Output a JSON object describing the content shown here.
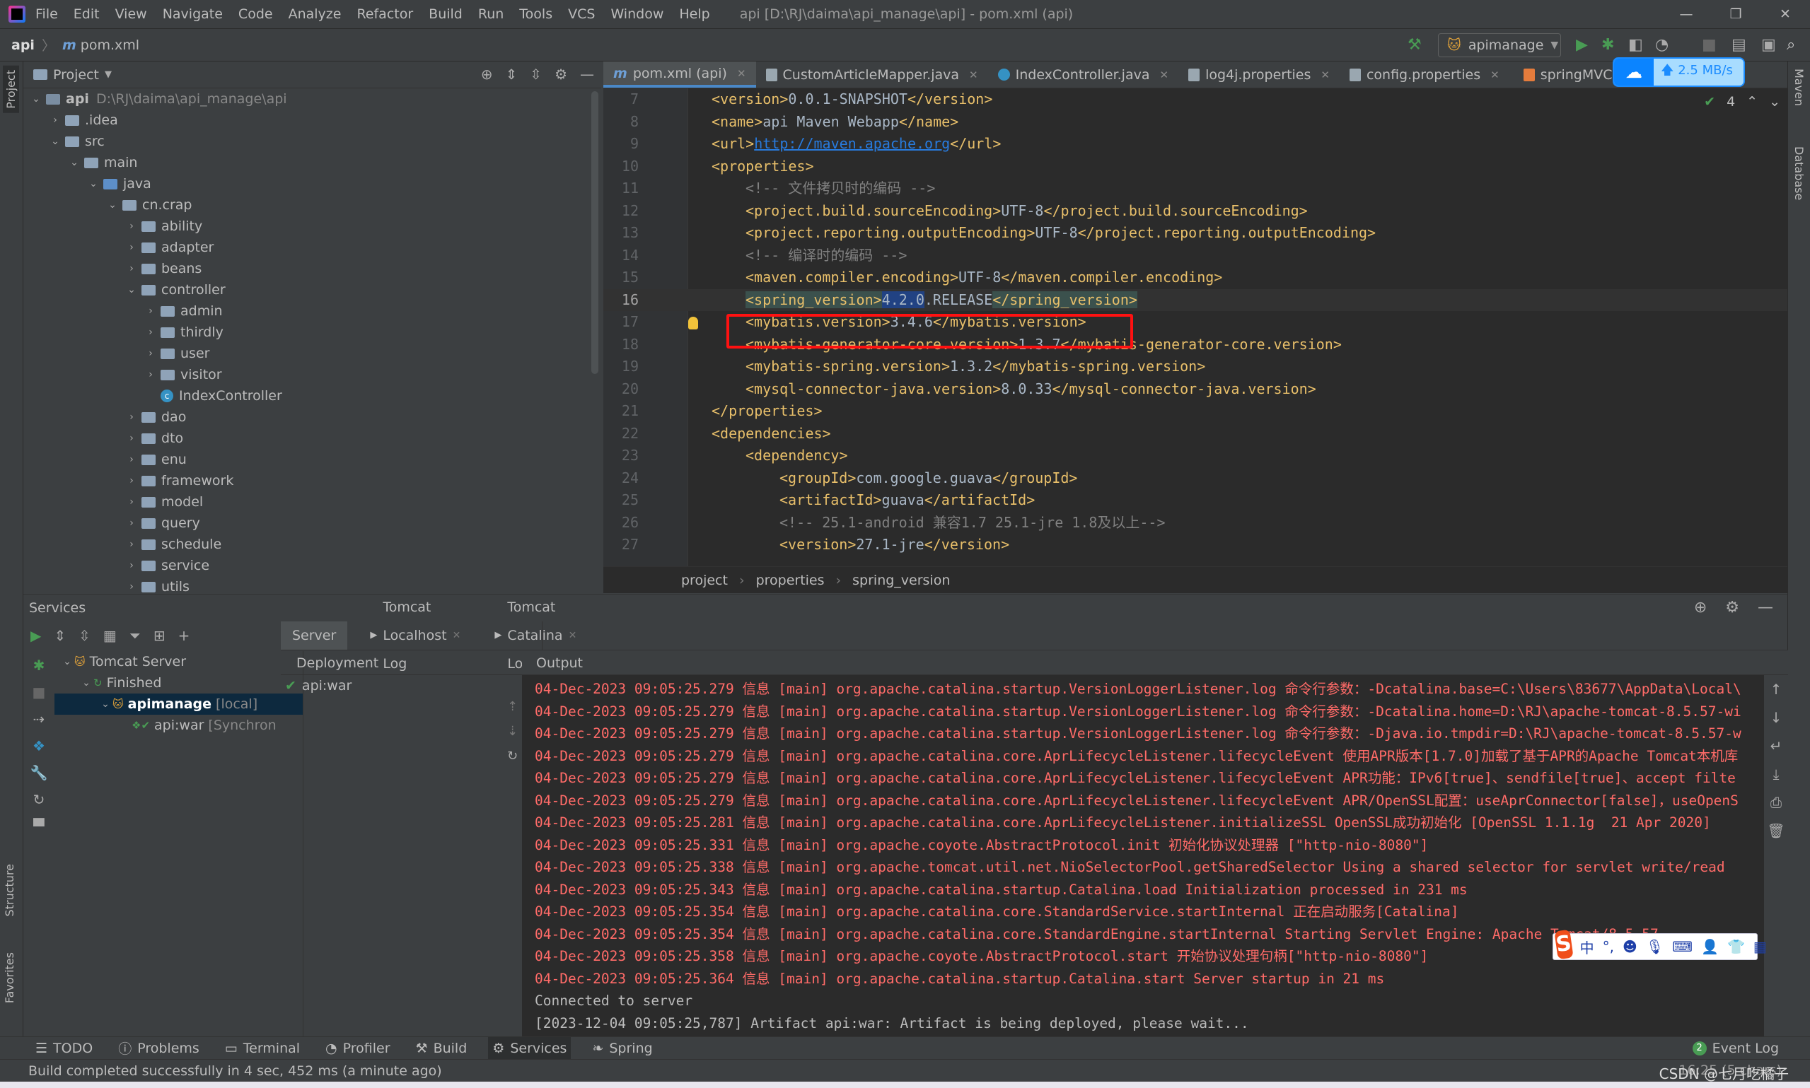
{
  "titlebar": {
    "menu": [
      "File",
      "Edit",
      "View",
      "Navigate",
      "Code",
      "Analyze",
      "Refactor",
      "Build",
      "Run",
      "Tools",
      "VCS",
      "Window",
      "Help"
    ],
    "title": "api [D:\\RJ\\daima\\api_manage\\api] - pom.xml (api)"
  },
  "navbar": {
    "crumbs": [
      "api",
      "pom.xml"
    ],
    "run_config": "apimanage"
  },
  "left_stripe": {
    "labels": [
      "Project",
      "Structure",
      "Favorites"
    ]
  },
  "right_stripe": {
    "labels": [
      "Maven",
      "Database"
    ]
  },
  "project": {
    "title": "Project",
    "tree": [
      {
        "label": "api",
        "path": "D:\\RJ\\daima\\api_manage\\api",
        "depth": 0,
        "arrow": "open",
        "icon": "module"
      },
      {
        "label": ".idea",
        "depth": 1,
        "arrow": "closed",
        "icon": "folder"
      },
      {
        "label": "src",
        "depth": 1,
        "arrow": "open",
        "icon": "folder"
      },
      {
        "label": "main",
        "depth": 2,
        "arrow": "open",
        "icon": "folder"
      },
      {
        "label": "java",
        "depth": 3,
        "arrow": "open",
        "icon": "source"
      },
      {
        "label": "cn.crap",
        "depth": 4,
        "arrow": "open",
        "icon": "folder"
      },
      {
        "label": "ability",
        "depth": 5,
        "arrow": "closed",
        "icon": "folder"
      },
      {
        "label": "adapter",
        "depth": 5,
        "arrow": "closed",
        "icon": "folder"
      },
      {
        "label": "beans",
        "depth": 5,
        "arrow": "closed",
        "icon": "folder"
      },
      {
        "label": "controller",
        "depth": 5,
        "arrow": "open",
        "icon": "folder"
      },
      {
        "label": "admin",
        "depth": 6,
        "arrow": "closed",
        "icon": "folder"
      },
      {
        "label": "thirdly",
        "depth": 6,
        "arrow": "closed",
        "icon": "folder"
      },
      {
        "label": "user",
        "depth": 6,
        "arrow": "closed",
        "icon": "folder"
      },
      {
        "label": "visitor",
        "depth": 6,
        "arrow": "closed",
        "icon": "folder"
      },
      {
        "label": "IndexController",
        "depth": 6,
        "arrow": "none",
        "icon": "class"
      },
      {
        "label": "dao",
        "depth": 5,
        "arrow": "closed",
        "icon": "folder"
      },
      {
        "label": "dto",
        "depth": 5,
        "arrow": "closed",
        "icon": "folder"
      },
      {
        "label": "enu",
        "depth": 5,
        "arrow": "closed",
        "icon": "folder"
      },
      {
        "label": "framework",
        "depth": 5,
        "arrow": "closed",
        "icon": "folder"
      },
      {
        "label": "model",
        "depth": 5,
        "arrow": "closed",
        "icon": "folder"
      },
      {
        "label": "query",
        "depth": 5,
        "arrow": "closed",
        "icon": "folder"
      },
      {
        "label": "schedule",
        "depth": 5,
        "arrow": "closed",
        "icon": "folder"
      },
      {
        "label": "service",
        "depth": 5,
        "arrow": "closed",
        "icon": "folder"
      },
      {
        "label": "utils",
        "depth": 5,
        "arrow": "closed",
        "icon": "folder"
      }
    ]
  },
  "editor": {
    "tabs": [
      {
        "label": "pom.xml (api)",
        "icon": "m",
        "active": true
      },
      {
        "label": "CustomArticleMapper.java",
        "icon": "f"
      },
      {
        "label": "IndexController.java",
        "icon": "c"
      },
      {
        "label": "log4j.properties",
        "icon": "f"
      },
      {
        "label": "config.properties",
        "icon": "f"
      },
      {
        "label": "springMVC.xml",
        "icon": "x"
      }
    ],
    "upload_widget": "2.5 MB/s",
    "inspection_count": "4",
    "lines": [
      {
        "n": "7",
        "i": 1,
        "p": [
          [
            "<version>",
            "tag"
          ],
          [
            "0.0.1-SNAPSHOT",
            "txt"
          ],
          [
            "</version>",
            "tag"
          ]
        ]
      },
      {
        "n": "8",
        "i": 1,
        "p": [
          [
            "<name>",
            "tag"
          ],
          [
            "api Maven Webapp",
            "txt"
          ],
          [
            "</name>",
            "tag"
          ]
        ]
      },
      {
        "n": "9",
        "i": 1,
        "p": [
          [
            "<url>",
            "tag"
          ],
          [
            "http://maven.apache.org",
            "url"
          ],
          [
            "</url>",
            "tag"
          ]
        ]
      },
      {
        "n": "10",
        "i": 1,
        "p": [
          [
            "<properties>",
            "tag"
          ]
        ]
      },
      {
        "n": "11",
        "i": 2,
        "p": [
          [
            "<!-- 文件拷贝时的编码 -->",
            "com"
          ]
        ]
      },
      {
        "n": "12",
        "i": 2,
        "p": [
          [
            "<project.build.sourceEncoding>",
            "tag"
          ],
          [
            "UTF-8",
            "txt"
          ],
          [
            "</project.build.sourceEncoding>",
            "tag"
          ]
        ]
      },
      {
        "n": "13",
        "i": 2,
        "p": [
          [
            "<project.reporting.outputEncoding>",
            "tag"
          ],
          [
            "UTF-8",
            "txt"
          ],
          [
            "</project.reporting.outputEncoding>",
            "tag"
          ]
        ]
      },
      {
        "n": "14",
        "i": 2,
        "p": [
          [
            "<!-- 编译时的编码 -->",
            "com"
          ]
        ]
      },
      {
        "n": "15",
        "i": 2,
        "p": [
          [
            "<maven.compiler.encoding>",
            "tag"
          ],
          [
            "UTF-8",
            "txt"
          ],
          [
            "</maven.compiler.encoding>",
            "tag"
          ]
        ]
      },
      {
        "n": "16",
        "i": 2,
        "cur": true,
        "p": [
          [
            "<spring_version>",
            "tag hl"
          ],
          [
            "4.2.0",
            "txt sel"
          ],
          [
            ".RELEASE",
            "txt"
          ],
          [
            "</spring_version>",
            "tag hl"
          ]
        ]
      },
      {
        "n": "17",
        "i": 2,
        "p": [
          [
            "<mybatis.version>",
            "tag"
          ],
          [
            "3.4.6",
            "txt"
          ],
          [
            "</mybatis.version>",
            "tag"
          ]
        ]
      },
      {
        "n": "18",
        "i": 2,
        "p": [
          [
            "<mybatis-generator-core.version>",
            "tag"
          ],
          [
            "1.3.7",
            "txt"
          ],
          [
            "</mybatis-generator-core.version>",
            "tag"
          ]
        ]
      },
      {
        "n": "19",
        "i": 2,
        "p": [
          [
            "<mybatis-spring.version>",
            "tag"
          ],
          [
            "1.3.2",
            "txt"
          ],
          [
            "</mybatis-spring.version>",
            "tag"
          ]
        ]
      },
      {
        "n": "20",
        "i": 2,
        "p": [
          [
            "<mysql-connector-java.version>",
            "tag"
          ],
          [
            "8.0.33",
            "txt"
          ],
          [
            "</mysql-connector-java.version>",
            "tag"
          ]
        ]
      },
      {
        "n": "21",
        "i": 1,
        "p": [
          [
            "</properties>",
            "tag"
          ]
        ]
      },
      {
        "n": "22",
        "i": 1,
        "p": [
          [
            "<dependencies>",
            "tag"
          ]
        ]
      },
      {
        "n": "23",
        "i": 2,
        "p": [
          [
            "<dependency>",
            "tag"
          ]
        ]
      },
      {
        "n": "24",
        "i": 3,
        "p": [
          [
            "<groupId>",
            "tag"
          ],
          [
            "com.google.guava",
            "txt"
          ],
          [
            "</groupId>",
            "tag"
          ]
        ]
      },
      {
        "n": "25",
        "i": 3,
        "p": [
          [
            "<artifactId>",
            "tag"
          ],
          [
            "guava",
            "txt"
          ],
          [
            "</artifactId>",
            "tag"
          ]
        ]
      },
      {
        "n": "26",
        "i": 3,
        "p": [
          [
            "<!-- 25.1-android 兼容1.7 25.1-jre 1.8及以上-->",
            "com"
          ]
        ]
      },
      {
        "n": "27",
        "i": 3,
        "p": [
          [
            "<version>",
            "tag"
          ],
          [
            "27.1-jre",
            "txt"
          ],
          [
            "</version>",
            "tag"
          ]
        ]
      }
    ],
    "breadcrumbs": [
      "project",
      "properties",
      "spring_version"
    ]
  },
  "services": {
    "title": "Services",
    "tree": [
      {
        "label": "Tomcat Server",
        "depth": 0,
        "arrow": "open"
      },
      {
        "label": "Finished",
        "depth": 1,
        "arrow": "open"
      },
      {
        "label": "apimanage",
        "suffix": "[local]",
        "depth": 2,
        "arrow": "open",
        "selected": true
      },
      {
        "label": "api:war",
        "suffix": "[Synchron",
        "depth": 3,
        "arrow": "none"
      }
    ],
    "tabs": [
      "Server",
      "Tomcat Localhost Log",
      "Tomcat Catalina Log"
    ],
    "deployment_header": "Deployment",
    "deployment_item": "api:war",
    "output_header": "Output",
    "log": [
      {
        "t": "04-Dec-2023 09:05:25.279 信息 [main] org.apache.catalina.startup.VersionLoggerListener.log 命令行参数：-Dcatalina.base=C:\\Users\\83677\\AppData\\Local\\",
        "k": "err"
      },
      {
        "t": "04-Dec-2023 09:05:25.279 信息 [main] org.apache.catalina.startup.VersionLoggerListener.log 命令行参数：-Dcatalina.home=D:\\RJ\\apache-tomcat-8.5.57-wi",
        "k": "err"
      },
      {
        "t": "04-Dec-2023 09:05:25.279 信息 [main] org.apache.catalina.startup.VersionLoggerListener.log 命令行参数：-Djava.io.tmpdir=D:\\RJ\\apache-tomcat-8.5.57-w",
        "k": "err"
      },
      {
        "t": "04-Dec-2023 09:05:25.279 信息 [main] org.apache.catalina.core.AprLifecycleListener.lifecycleEvent 使用APR版本[1.7.0]加载了基于APR的Apache Tomcat本机库",
        "k": "err"
      },
      {
        "t": "04-Dec-2023 09:05:25.279 信息 [main] org.apache.catalina.core.AprLifecycleListener.lifecycleEvent APR功能：IPv6[true]、sendfile[true]、accept filte",
        "k": "err"
      },
      {
        "t": "04-Dec-2023 09:05:25.279 信息 [main] org.apache.catalina.core.AprLifecycleListener.lifecycleEvent APR/OpenSSL配置：useAprConnector[false]，useOpenS",
        "k": "err"
      },
      {
        "t": "04-Dec-2023 09:05:25.281 信息 [main] org.apache.catalina.core.AprLifecycleListener.initializeSSL OpenSSL成功初始化 [OpenSSL 1.1.1g  21 Apr 2020]",
        "k": "err"
      },
      {
        "t": "04-Dec-2023 09:05:25.331 信息 [main] org.apache.coyote.AbstractProtocol.init 初始化协议处理器 [\"http-nio-8080\"]",
        "k": "err"
      },
      {
        "t": "04-Dec-2023 09:05:25.338 信息 [main] org.apache.tomcat.util.net.NioSelectorPool.getSharedSelector Using a shared selector for servlet write/read",
        "k": "err"
      },
      {
        "t": "04-Dec-2023 09:05:25.343 信息 [main] org.apache.catalina.startup.Catalina.load Initialization processed in 231 ms",
        "k": "err"
      },
      {
        "t": "04-Dec-2023 09:05:25.354 信息 [main] org.apache.catalina.core.StandardService.startInternal 正在启动服务[Catalina]",
        "k": "err"
      },
      {
        "t": "04-Dec-2023 09:05:25.354 信息 [main] org.apache.catalina.core.StandardEngine.startInternal Starting Servlet Engine: Apache Tomcat/8.5.57",
        "k": "err"
      },
      {
        "t": "04-Dec-2023 09:05:25.358 信息 [main] org.apache.coyote.AbstractProtocol.start 开始协议处理句柄[\"http-nio-8080\"]",
        "k": "err"
      },
      {
        "t": "04-Dec-2023 09:05:25.364 信息 [main] org.apache.catalina.startup.Catalina.start Server startup in 21 ms",
        "k": "err"
      },
      {
        "t": "Connected to server",
        "k": "norm"
      },
      {
        "t": "[2023-12-04 09:05:25,787] Artifact api:war: Artifact is being deployed, please wait...",
        "k": "norm"
      }
    ]
  },
  "ime": {
    "label": "中"
  },
  "bottom_tools": [
    "TODO",
    "Problems",
    "Terminal",
    "Profiler",
    "Build",
    "Services",
    "Spring"
  ],
  "active_tool": "Services",
  "event_log": {
    "label": "Event Log",
    "count": "2"
  },
  "status": {
    "message": "Build completed successfully in 4 sec, 452 ms (a minute ago)",
    "position": "16:25 (5 chars)",
    "watermark": "CSDN @七月吃橘子"
  },
  "colors": {
    "accent": "#4a88c7",
    "error_log": "#ff6b68",
    "highlight_box": "#ff1111",
    "tag": "#e8bf6a"
  }
}
